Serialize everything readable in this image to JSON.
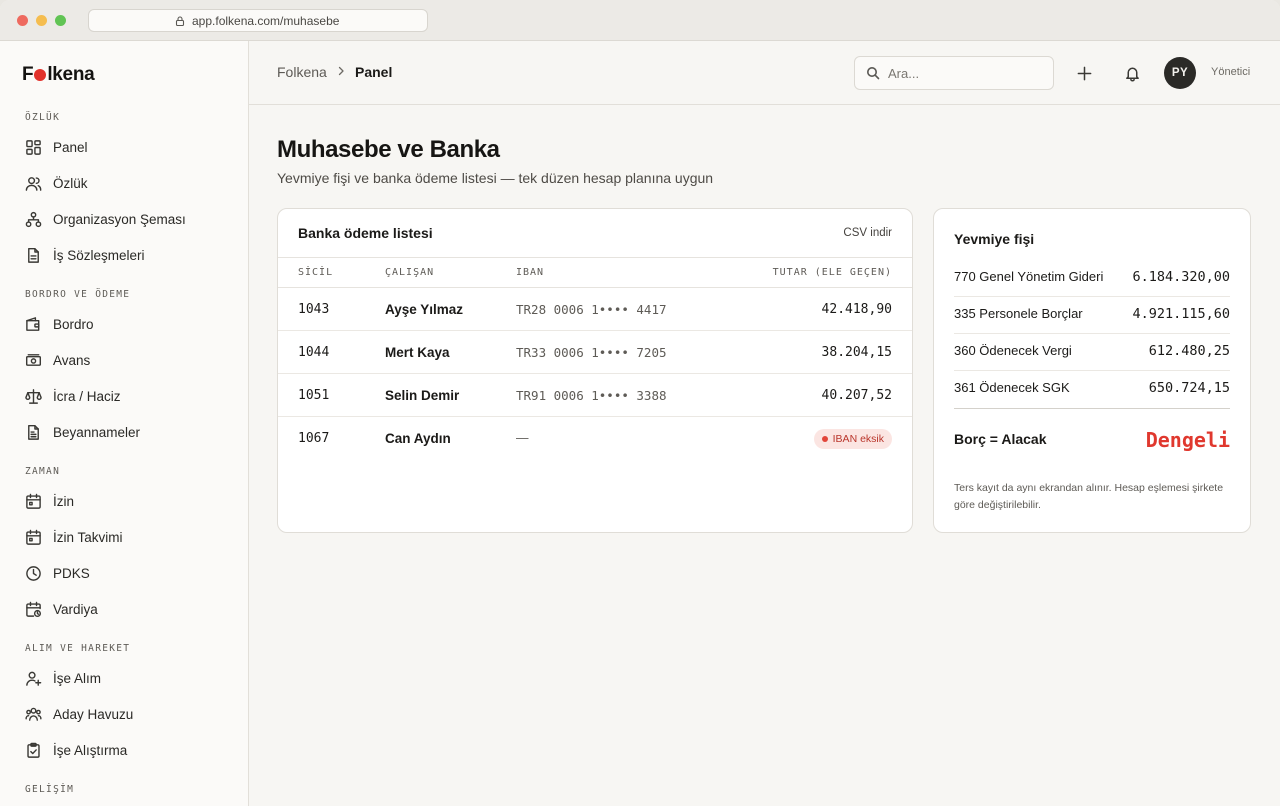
{
  "browser": {
    "url": "app.folkena.com/muhasebe"
  },
  "brand": {
    "name_part1": "F",
    "name_part2": "lkena"
  },
  "sidebar": {
    "sections": [
      {
        "title": "ÖZLÜK",
        "items": [
          "Panel",
          "Özlük",
          "Organizasyon Şeması",
          "İş Sözleşmeleri"
        ]
      },
      {
        "title": "BORDRO VE ÖDEME",
        "items": [
          "Bordro",
          "Avans",
          "İcra / Haciz",
          "Beyannameler"
        ]
      },
      {
        "title": "ZAMAN",
        "items": [
          "İzin",
          "İzin Takvimi",
          "PDKS",
          "Vardiya"
        ]
      },
      {
        "title": "ALIM VE HAREKET",
        "items": [
          "İşe Alım",
          "Aday Havuzu",
          "İşe Alıştırma"
        ]
      },
      {
        "title": "GELİŞİM",
        "items": []
      }
    ]
  },
  "topbar": {
    "breadcrumb": [
      "Folkena",
      "Panel"
    ],
    "search_placeholder": "Ara...",
    "avatar_initials": "PY",
    "role": "Yönetici"
  },
  "page": {
    "title": "Muhasebe ve Banka",
    "subtitle": "Yevmiye fişi ve banka ödeme listesi — tek düzen hesap planına uygun"
  },
  "bank_list": {
    "title": "Banka ödeme listesi",
    "csv_label": "CSV indir",
    "columns": [
      "SİCİL",
      "ÇALIŞAN",
      "IBAN",
      "TUTAR (ELE GEÇEN)"
    ],
    "rows": [
      {
        "sicil": "1043",
        "name": "Ayşe Yılmaz",
        "iban": "TR28 0006 1•••• 4417",
        "amount": "42.418,90"
      },
      {
        "sicil": "1044",
        "name": "Mert Kaya",
        "iban": "TR33 0006 1•••• 7205",
        "amount": "38.204,15"
      },
      {
        "sicil": "1051",
        "name": "Selin Demir",
        "iban": "TR91 0006 1•••• 3388",
        "amount": "40.207,52"
      },
      {
        "sicil": "1067",
        "name": "Can Aydın",
        "iban": "—",
        "badge": "IBAN eksik"
      }
    ]
  },
  "journal": {
    "title": "Yevmiye fişi",
    "entries": [
      {
        "account": "770 Genel Yönetim Gideri",
        "value": "6.184.320,00"
      },
      {
        "account": "335 Personele Borçlar",
        "value": "4.921.115,60"
      },
      {
        "account": "360 Ödenecek Vergi",
        "value": "612.480,25"
      },
      {
        "account": "361 Ödenecek SGK",
        "value": "650.724,15"
      }
    ],
    "balance_label": "Borç = Alacak",
    "balance_value": "Dengeli",
    "note": "Ters kayıt da aynı ekrandan alınır. Hesap eşlemesi şirkete göre değiştirilebilir."
  },
  "colors": {
    "accent": "#e0382e",
    "badge_bg": "#fbe5e2",
    "avatar_bg": "#2b2a27"
  }
}
